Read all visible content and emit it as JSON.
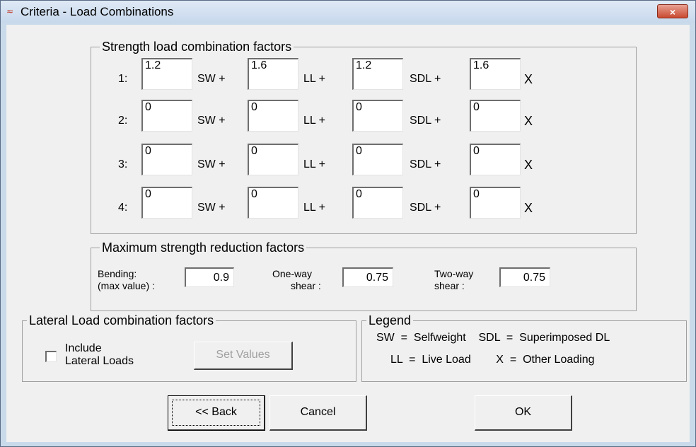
{
  "window": {
    "title": "Criteria - Load Combinations",
    "close_label": "×"
  },
  "strength": {
    "title": "Strength load combination factors",
    "rows": [
      {
        "label": "1:",
        "sw": "1.2",
        "ll": "1.6",
        "sdl": "1.2",
        "x": "1.6"
      },
      {
        "label": "2:",
        "sw": "0",
        "ll": "0",
        "sdl": "0",
        "x": "0"
      },
      {
        "label": "3:",
        "sw": "0",
        "ll": "0",
        "sdl": "0",
        "x": "0"
      },
      {
        "label": "4:",
        "sw": "0",
        "ll": "0",
        "sdl": "0",
        "x": "0"
      }
    ],
    "sw_suffix": "SW +",
    "ll_suffix": "LL +",
    "sdl_suffix": "SDL +",
    "x_suffix": "X"
  },
  "reduction": {
    "title": "Maximum strength reduction factors",
    "bending_label_1": "Bending:",
    "bending_label_2": "(max value) :",
    "bending_value": "0.9",
    "oneway_label_1": "One-way",
    "oneway_label_2": "shear :",
    "oneway_value": "0.75",
    "twoway_label_1": "Two-way",
    "twoway_label_2": "shear :",
    "twoway_value": "0.75"
  },
  "lateral": {
    "title": "Lateral Load combination factors",
    "checkbox_label_1": "Include",
    "checkbox_label_2": "Lateral Loads",
    "checked": false,
    "set_values_label": "Set Values"
  },
  "legend": {
    "title": "Legend",
    "line1": "SW  =  Selfweight    SDL  =  Superimposed DL",
    "line2": "LL  =  Live Load        X  =  Other Loading"
  },
  "buttons": {
    "back": "<< Back",
    "cancel": "Cancel",
    "ok": "OK"
  }
}
